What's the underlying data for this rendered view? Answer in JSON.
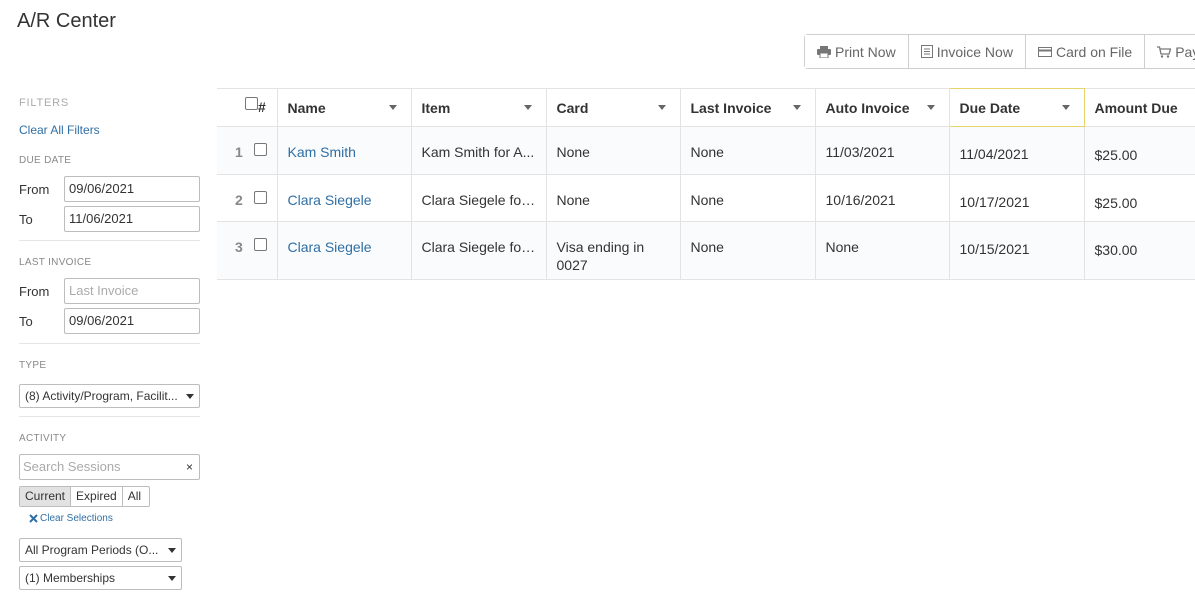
{
  "page": {
    "title": "A/R Center"
  },
  "toolbar": {
    "print_now": "Print Now",
    "invoice_now": "Invoice Now",
    "card_on_file": "Card on File",
    "pay": "Pay"
  },
  "filters": {
    "heading": "FILTERS",
    "clear_all": "Clear All Filters",
    "due_date": {
      "heading": "DUE DATE",
      "from_label": "From",
      "from_value": "09/06/2021",
      "to_label": "To",
      "to_value": "11/06/2021"
    },
    "last_invoice": {
      "heading": "LAST INVOICE",
      "from_label": "From",
      "from_placeholder": "Last Invoice",
      "to_label": "To",
      "to_value": "09/06/2021"
    },
    "type": {
      "heading": "TYPE",
      "selected": "(8) Activity/Program, Facilit..."
    },
    "activity": {
      "heading": "ACTIVITY",
      "search_placeholder": "Search Sessions",
      "clear_icon": "×",
      "segments": [
        "Current",
        "Expired",
        "All"
      ],
      "active_segment": "Current",
      "clear_selections": "Clear Selections",
      "program_periods": "All Program Periods (O...",
      "memberships": "(1) Memberships"
    }
  },
  "table": {
    "columns": {
      "num": "#",
      "name": "Name",
      "item": "Item",
      "card": "Card",
      "last_invoice": "Last Invoice",
      "auto_invoice": "Auto Invoice",
      "due_date": "Due Date",
      "amount_due": "Amount Due"
    },
    "rows": [
      {
        "num": "1",
        "name": "Kam Smith",
        "item": "Kam Smith for A...",
        "card": "None",
        "card2": "",
        "last_invoice": "None",
        "auto_invoice": "11/03/2021",
        "due_date": "11/04/2021",
        "amount_due": "$25.00"
      },
      {
        "num": "2",
        "name": "Clara Siegele",
        "item": "Clara Siegele for ...",
        "card": "None",
        "card2": "",
        "last_invoice": "None",
        "auto_invoice": "10/16/2021",
        "due_date": "10/17/2021",
        "amount_due": "$25.00"
      },
      {
        "num": "3",
        "name": "Clara Siegele",
        "item": "Clara Siegele for ...",
        "card": "Visa ending in",
        "card2": "0027",
        "last_invoice": "None",
        "auto_invoice": "None",
        "due_date": "10/15/2021",
        "amount_due": "$30.00"
      }
    ]
  },
  "colors": {
    "link": "#2f6fa5",
    "highlight_border": "#e6d46a"
  }
}
